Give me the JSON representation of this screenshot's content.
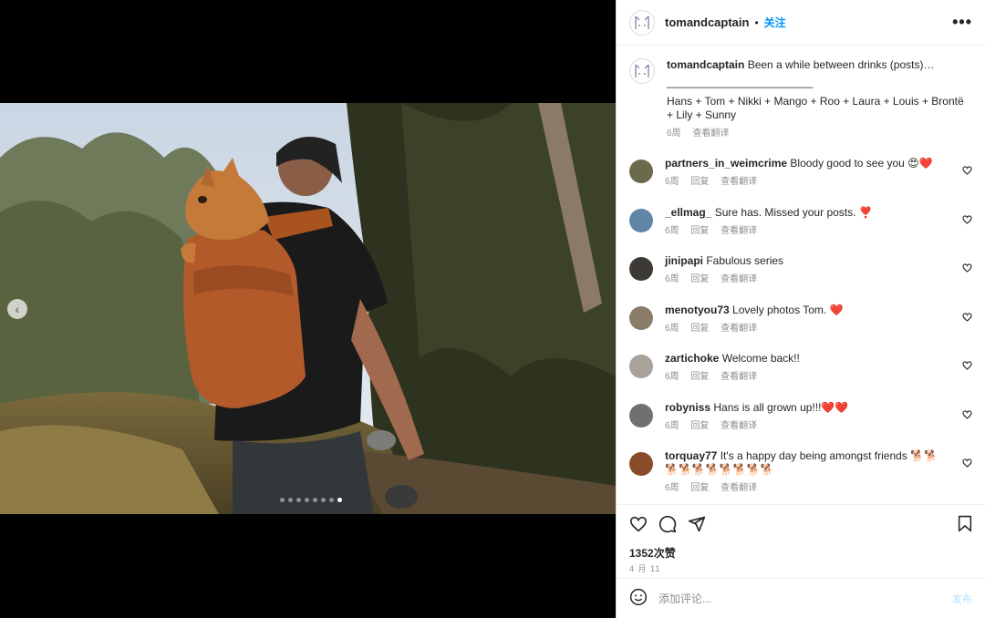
{
  "post": {
    "username": "tomandcaptain",
    "separator": "•",
    "follow_label": "关注",
    "more_label": "•••"
  },
  "caption": {
    "username": "tomandcaptain",
    "text": "Been a while between drinks (posts)…",
    "rule": "________________________",
    "names": "Hans + Tom + Nikki + Mango + Roo + Laura + Louis + Brontë + Lily + Sunny",
    "time": "6周",
    "translate": "查看翻译"
  },
  "comments": [
    {
      "username": "partners_in_weimcrime",
      "text": "Bloody good to see you 😍❤️",
      "time": "6周",
      "reply": "回复",
      "translate": "查看翻译",
      "avatar_color": "#6b6a4a"
    },
    {
      "username": "_ellmag_",
      "text": "Sure has. Missed your posts. ❣️",
      "time": "6周",
      "reply": "回复",
      "translate": "查看翻译",
      "avatar_color": "#5f86a6"
    },
    {
      "username": "jinipapi",
      "text": "Fabulous series",
      "time": "6周",
      "reply": "回复",
      "translate": "查看翻译",
      "avatar_color": "#3d3a36"
    },
    {
      "username": "menotyou73",
      "text": "Lovely photos Tom. ❤️",
      "time": "6周",
      "reply": "回复",
      "translate": "查看翻译",
      "avatar_color": "#8b7c6a"
    },
    {
      "username": "zartichoke",
      "text": "Welcome back!!",
      "time": "6周",
      "reply": "回复",
      "translate": "查看翻译",
      "avatar_color": "#a9a29b"
    },
    {
      "username": "robyniss",
      "text": "Hans is all grown up!!!❤️❤️",
      "time": "6周",
      "reply": "回复",
      "translate": "查看翻译",
      "avatar_color": "#707070"
    },
    {
      "username": "torquay77",
      "text": "It's a happy day being amongst friends 🐕🐕🐕🐕🐕🐕🐕🐕🐕🐕",
      "time": "6周",
      "reply": "回复",
      "translate": "查看翻译",
      "avatar_color": "#8a4b2a"
    }
  ],
  "stats": {
    "likes": "1352次赞",
    "date": "4 月 11"
  },
  "composer": {
    "placeholder": "添加评论...",
    "post_label": "发布"
  },
  "carousel": {
    "slide_count": 8,
    "active_index": 7
  },
  "colors": {
    "accent": "#0095f6",
    "muted": "#8e8e8e"
  },
  "icons": [
    "chevron-left-icon",
    "more-icon",
    "heart-icon",
    "comment-icon",
    "share-icon",
    "bookmark-icon",
    "emoji-icon"
  ]
}
